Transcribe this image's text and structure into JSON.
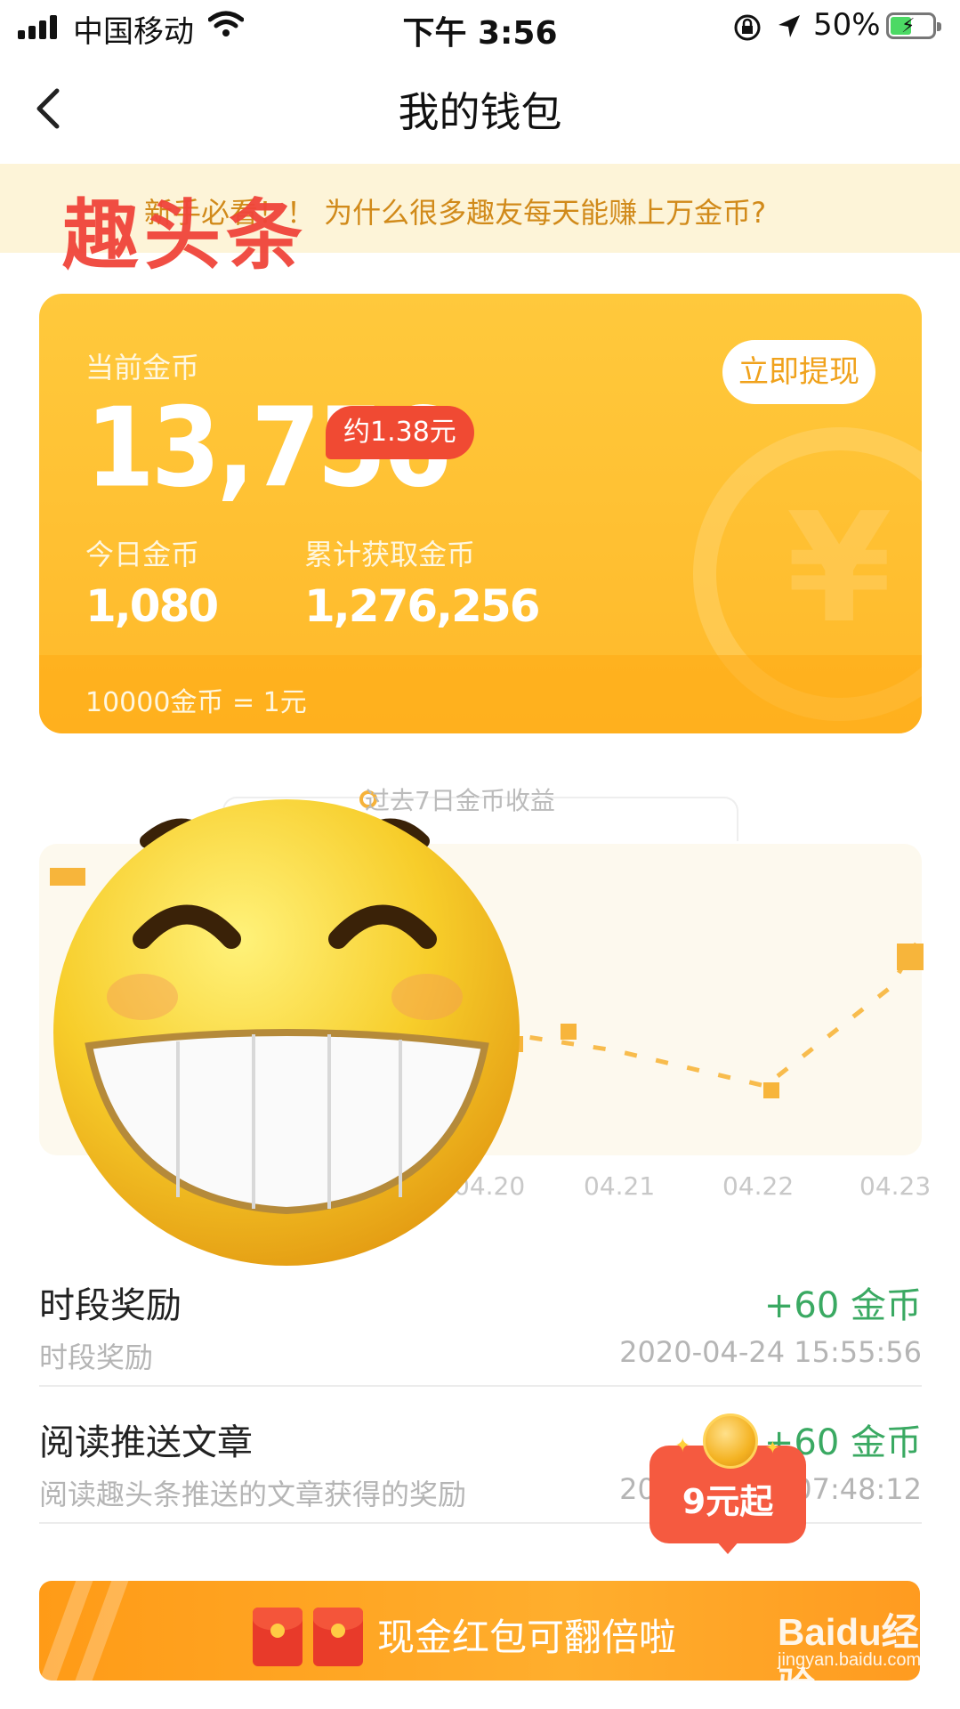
{
  "status_bar": {
    "carrier": "中国移动",
    "time": "下午 3:56",
    "battery_percent": "50%",
    "battery_level": 0.5,
    "icons": [
      "signal-icon",
      "wifi-icon",
      "orientation-lock-icon",
      "location-icon",
      "battery-icon"
    ]
  },
  "nav": {
    "title": "我的钱包",
    "back_icon": "chevron-left-icon"
  },
  "notice": {
    "text": "新手必看！！ 为什么很多趣友每天能赚上万金币?",
    "logo": "趣头条"
  },
  "wallet": {
    "current_label": "当前金币",
    "current_coins": "13,756",
    "approx_value": "约1.38元",
    "withdraw_label": "立即提现",
    "today_label": "今日金币",
    "today_value": "1,080",
    "total_label": "累计获取金币",
    "total_value": "1,276,256",
    "rate": "10000金币 = 1元",
    "accent": "#ffc93c"
  },
  "chart": {
    "title": "过去7日金币收益",
    "dates": [
      "04.20",
      "04.21",
      "04.22",
      "04.23"
    ]
  },
  "records": [
    {
      "title": "时段奖励",
      "amount": "+60 金币",
      "desc": "时段奖励",
      "time": "2020-04-24 15:55:56"
    },
    {
      "title": "阅读推送文章",
      "amount": "+60 金币",
      "desc": "阅读趣头条推送的文章获得的奖励",
      "time": "2020-04-24 07:48:12"
    }
  ],
  "badge": {
    "text": "9元起"
  },
  "bottom_banner": {
    "text": "现金红包可翻倍啦"
  },
  "watermark": {
    "brand": "Baidu经验",
    "url": "jingyan.baidu.com"
  },
  "colors": {
    "green": "#3aa962",
    "red": "#f04a33",
    "orange": "#ff9b17"
  }
}
